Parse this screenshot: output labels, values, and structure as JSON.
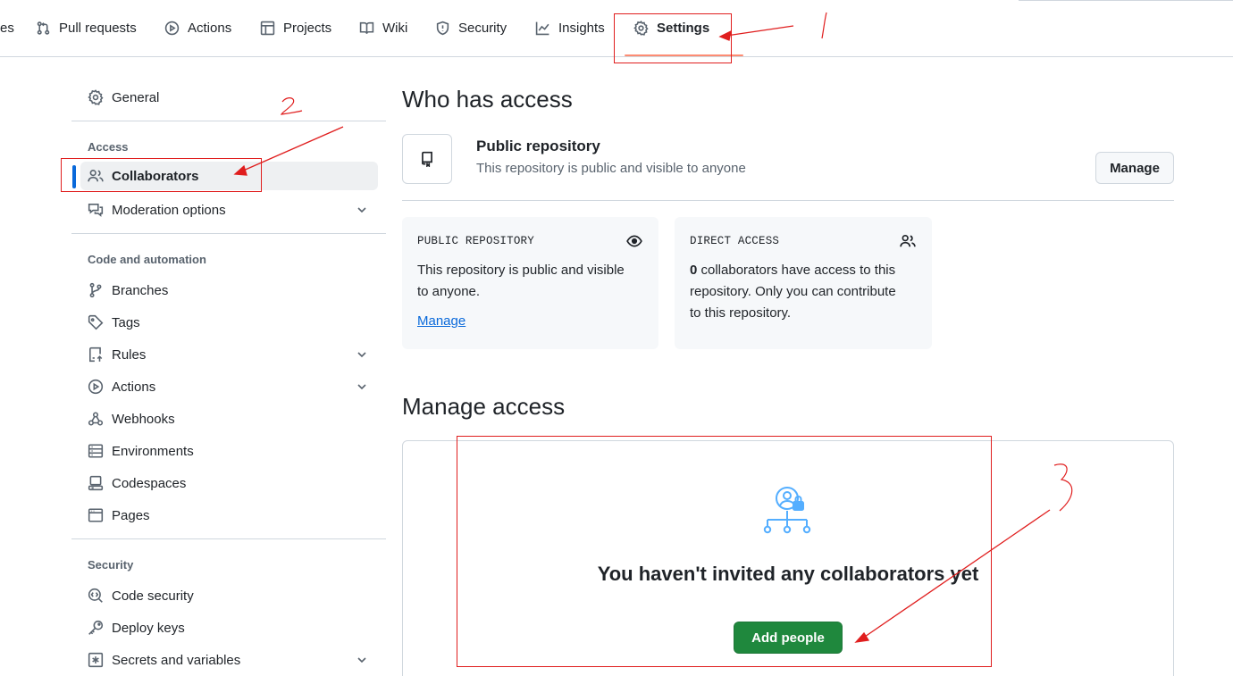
{
  "topnav": {
    "tabs": [
      {
        "label": "es",
        "icon": "partial-tab"
      },
      {
        "label": "Pull requests",
        "icon": "git-pull-request-icon"
      },
      {
        "label": "Actions",
        "icon": "play-icon"
      },
      {
        "label": "Projects",
        "icon": "table-icon"
      },
      {
        "label": "Wiki",
        "icon": "book-icon"
      },
      {
        "label": "Security",
        "icon": "shield-icon"
      },
      {
        "label": "Insights",
        "icon": "graph-icon"
      },
      {
        "label": "Settings",
        "icon": "gear-icon",
        "active": true
      }
    ]
  },
  "sidebar": {
    "general": "General",
    "access_heading": "Access",
    "collaborators": "Collaborators",
    "moderation": "Moderation options",
    "code_heading": "Code and automation",
    "branches": "Branches",
    "tags": "Tags",
    "rules": "Rules",
    "actions": "Actions",
    "webhooks": "Webhooks",
    "environments": "Environments",
    "codespaces": "Codespaces",
    "pages": "Pages",
    "security_heading": "Security",
    "code_security": "Code security",
    "deploy_keys": "Deploy keys",
    "secrets": "Secrets and variables"
  },
  "who_has_access": {
    "title": "Who has access",
    "repo_title": "Public repository",
    "repo_sub": "This repository is public and visible to anyone",
    "manage_button": "Manage",
    "public_card": {
      "label": "PUBLIC REPOSITORY",
      "text_line1": "This repository is public and visible",
      "text_line2": "to anyone.",
      "link": "Manage"
    },
    "direct_card": {
      "label": "DIRECT ACCESS",
      "count": "0",
      "text_line1_rest": " collaborators have access to this",
      "text_line2": "repository. Only you can contribute",
      "text_line3": "to this repository."
    }
  },
  "manage_access": {
    "title": "Manage access",
    "empty_title": "You haven't invited any collaborators yet",
    "add_button": "Add people"
  },
  "annotations": {
    "step1": "1",
    "step2": "2",
    "step3": "3",
    "color": "#e01e1e"
  }
}
